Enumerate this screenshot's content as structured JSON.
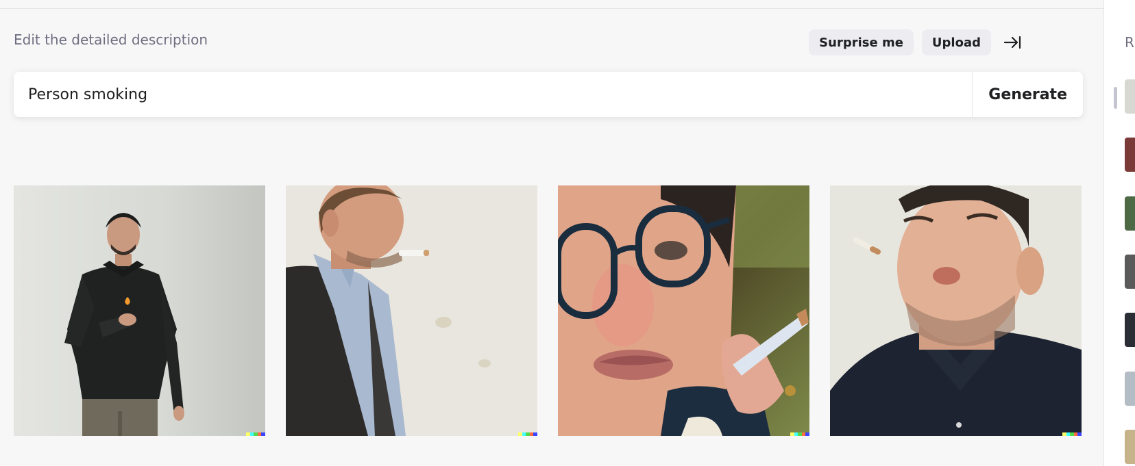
{
  "editor": {
    "label": "Edit the detailed description",
    "surprise_label": "Surprise me",
    "upload_label": "Upload",
    "prompt_value": "Person smoking",
    "generate_label": "Generate"
  },
  "images": [
    {
      "subject": "man in black shirt lighting a cigarette, full body"
    },
    {
      "subject": "man in dark blazer with cigarette in mouth, side profile"
    },
    {
      "subject": "woman with glasses holding a cigarette, close-up"
    },
    {
      "subject": "man in dark polo exhaling, cigarette in the air"
    }
  ],
  "sidebar": {
    "title": "R"
  },
  "colors": {
    "background": "#f7f7f8",
    "button_bg": "#ececf1",
    "label_gray": "#6e6e80",
    "text": "#202123"
  }
}
